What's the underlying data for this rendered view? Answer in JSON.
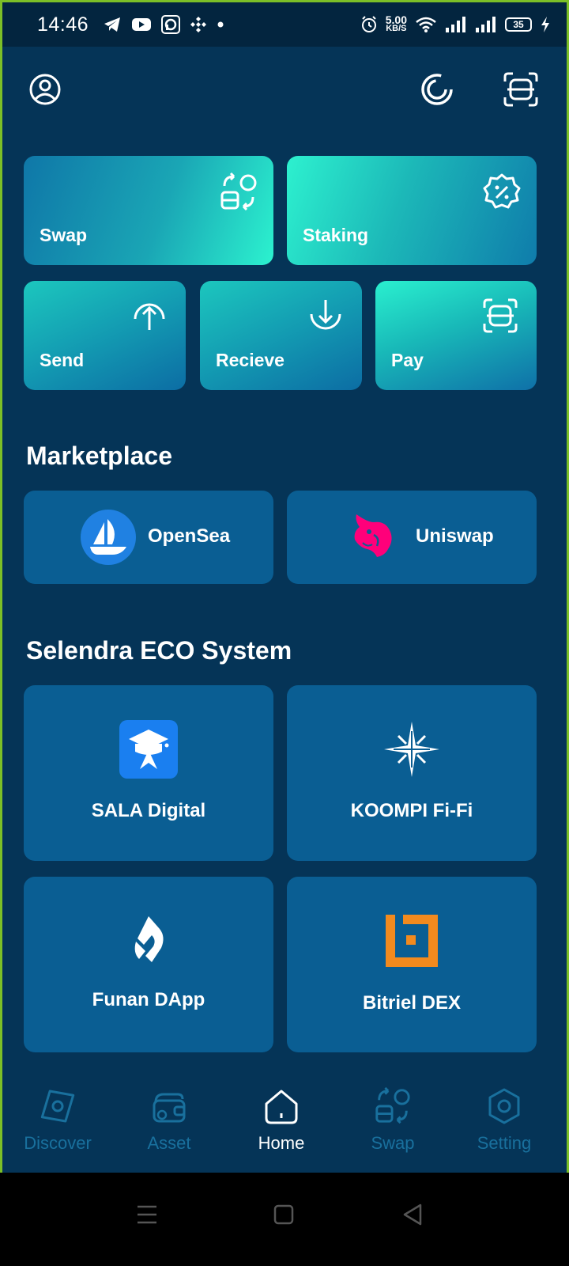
{
  "status_bar": {
    "time": "14:46",
    "net_speed_value": "5.00",
    "net_speed_unit": "KB/S",
    "battery": "35"
  },
  "actions": {
    "swap": "Swap",
    "staking": "Staking",
    "send": "Send",
    "receive": "Recieve",
    "pay": "Pay"
  },
  "marketplace": {
    "title": "Marketplace",
    "items": [
      {
        "label": "OpenSea"
      },
      {
        "label": "Uniswap"
      }
    ]
  },
  "ecosystem": {
    "title": "Selendra ECO System",
    "items": [
      {
        "label": "SALA Digital"
      },
      {
        "label": "KOOMPI Fi-Fi"
      },
      {
        "label": "Funan DApp"
      },
      {
        "label": "Bitriel DEX"
      }
    ]
  },
  "bottom_nav": {
    "items": [
      {
        "label": "Discover",
        "icon": "discover-icon",
        "active": false
      },
      {
        "label": "Asset",
        "icon": "wallet-icon",
        "active": false
      },
      {
        "label": "Home",
        "icon": "home-icon",
        "active": true
      },
      {
        "label": "Swap",
        "icon": "swap-icon",
        "active": false
      },
      {
        "label": "Setting",
        "icon": "settings-icon",
        "active": false
      }
    ]
  },
  "colors": {
    "background": "#053457",
    "card": "#0a5e93",
    "accent": "#2cf2cf",
    "inactive_nav": "#19709d"
  }
}
